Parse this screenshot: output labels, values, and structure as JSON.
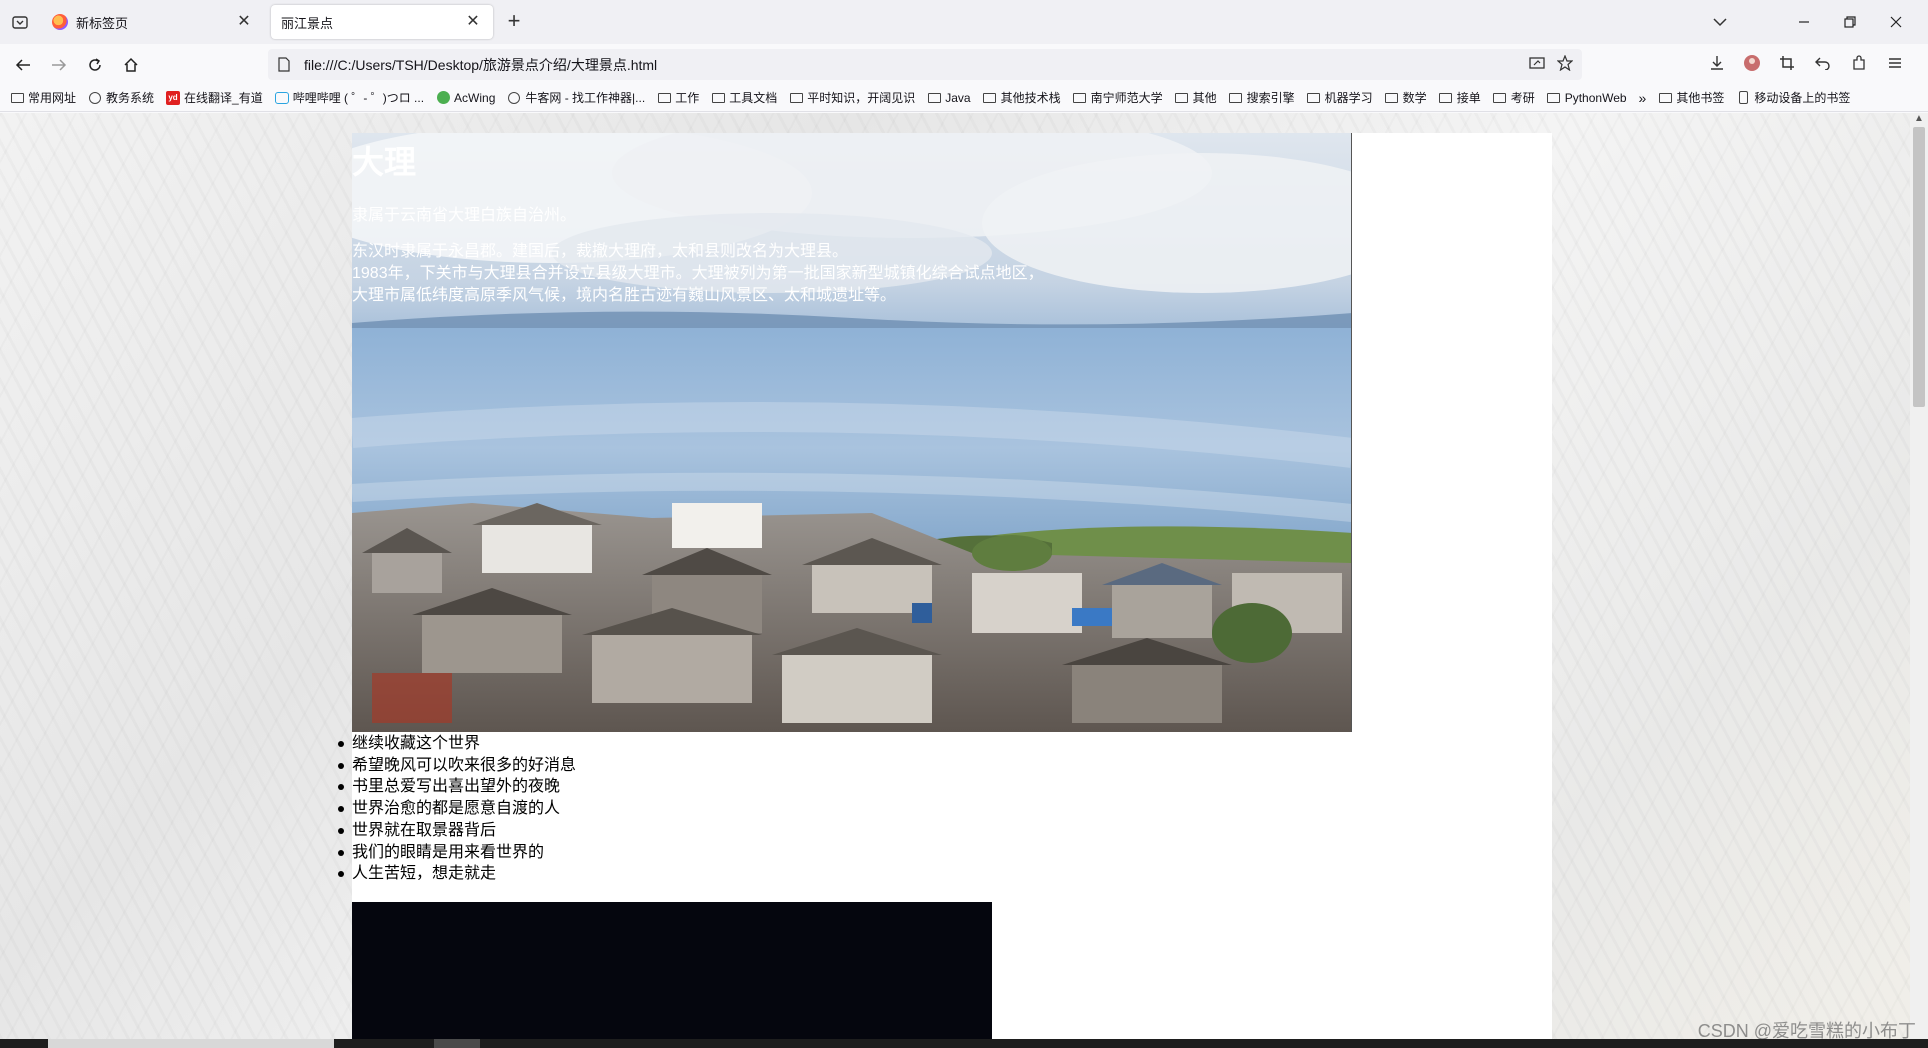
{
  "browser": {
    "tabs": [
      {
        "label": "新标签页",
        "active": false
      },
      {
        "label": "丽江景点",
        "active": true
      }
    ],
    "url": "file:///C:/Users/TSH/Desktop/旅游景点介绍/大理景点.html",
    "bookmarks": [
      {
        "label": "常用网址",
        "icon": "folder-icon"
      },
      {
        "label": "教务系统",
        "icon": "globe-icon"
      },
      {
        "label": "在线翻译_有道",
        "icon": "youdao-icon"
      },
      {
        "label": "哔哩哔哩 ( ゜- ゜)つロ ...",
        "icon": "bilibili-icon"
      },
      {
        "label": "AcWing",
        "icon": "acwing-icon"
      },
      {
        "label": "牛客网 - 找工作神器|...",
        "icon": "globe-icon"
      },
      {
        "label": "工作",
        "icon": "folder-icon"
      },
      {
        "label": "工具文档",
        "icon": "folder-icon"
      },
      {
        "label": "平时知识，开阔见识",
        "icon": "folder-icon"
      },
      {
        "label": "Java",
        "icon": "folder-icon"
      },
      {
        "label": "其他技术栈",
        "icon": "folder-icon"
      },
      {
        "label": "南宁师范大学",
        "icon": "folder-icon"
      },
      {
        "label": "其他",
        "icon": "folder-icon"
      },
      {
        "label": "搜索引擎",
        "icon": "folder-icon"
      },
      {
        "label": "机器学习",
        "icon": "folder-icon"
      },
      {
        "label": "数学",
        "icon": "folder-icon"
      },
      {
        "label": "接单",
        "icon": "folder-icon"
      },
      {
        "label": "考研",
        "icon": "folder-icon"
      },
      {
        "label": "PythonWeb",
        "icon": "folder-icon"
      }
    ],
    "overflow_label": "»",
    "other_bookmarks": "其他书签",
    "mobile_bookmarks": "移动设备上的书签"
  },
  "page": {
    "heading": "大理",
    "intro": "隶属于云南省大理白族自治州。",
    "history_lines": [
      "东汉时隶属于永昌郡。建国后，裁撤大理府，太和县则改名为大理县。",
      "1983年，下关市与大理县合并设立县级大理市。大理被列为第一批国家新型城镇化综合试点地区，",
      "大理市属低纬度高原季风气候，境内名胜古迹有巍山风景区、太和城遗址等。"
    ],
    "quotes": [
      "继续收藏这个世界",
      "希望晚风可以吹来很多的好消息",
      "书里总爱写出喜出望外的夜晚",
      "世界治愈的都是愿意自渡的人",
      "世界就在取景器背后",
      "我们的眼睛是用来看世界的",
      "人生苦短，想走就走"
    ]
  },
  "watermark": "CSDN @爱吃雪糕的小布丁"
}
